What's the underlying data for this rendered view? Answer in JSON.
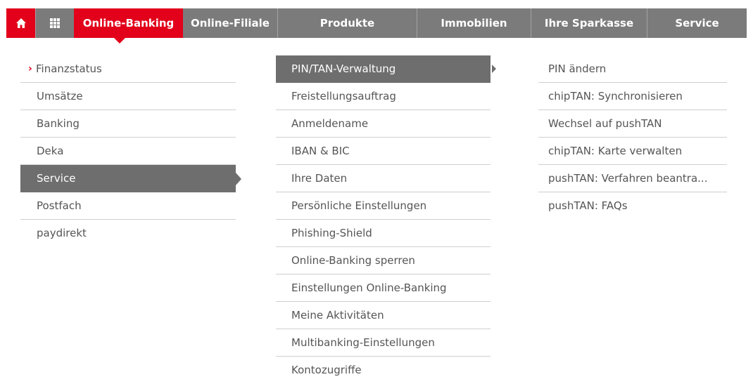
{
  "nav": {
    "home_icon": "home-icon",
    "grid_icon": "grid-icon",
    "items": [
      "Online-Banking",
      "Online-Filiale",
      "Produkte",
      "Immobilien",
      "Ihre Sparkasse",
      "Service"
    ]
  },
  "colors": {
    "brand_red": "#e2001a",
    "nav_gray": "#7b7b7b",
    "active_gray": "#6e6e6e"
  },
  "menu_level1": [
    "Finanzstatus",
    "Umsätze",
    "Banking",
    "Deka",
    "Service",
    "Postfach",
    "paydirekt"
  ],
  "menu_level2": [
    "PIN/TAN-Verwaltung",
    "Freistellungsauftrag",
    "Anmeldename",
    "IBAN & BIC",
    "Ihre Daten",
    "Persönliche Einstellungen",
    "Phishing-Shield",
    "Online-Banking sperren",
    "Einstellungen Online-Banking",
    "Meine Aktivitäten",
    "Multibanking-Einstellungen",
    "Kontozugriffe"
  ],
  "menu_level3": [
    "PIN ändern",
    "chipTAN: Synchronisieren",
    "Wechsel auf pushTAN",
    "chipTAN: Karte verwalten",
    "pushTAN: Verfahren beantra...",
    "pushTAN: FAQs"
  ],
  "chevron_icon": "chevron-right-icon"
}
